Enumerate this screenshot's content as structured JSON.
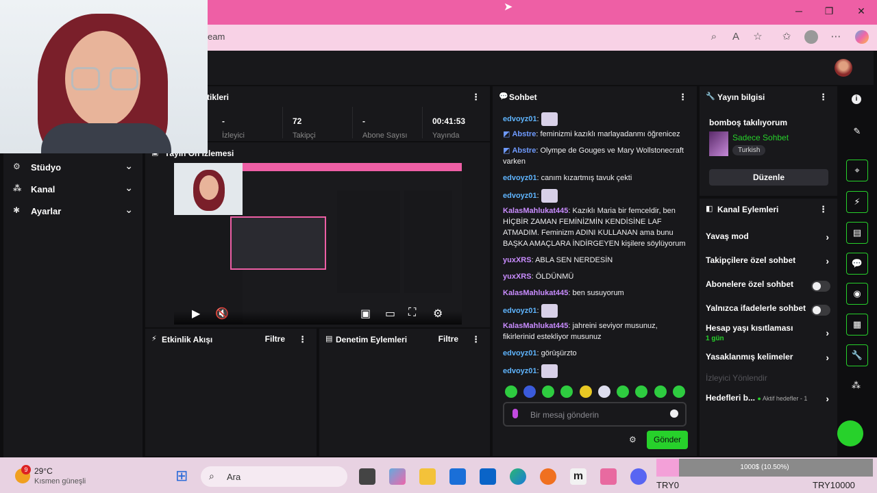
{
  "browser": {
    "url_text": "eam",
    "win_min": "─",
    "win_max": "❐",
    "win_close": "✕"
  },
  "sidebar": {
    "items": [
      {
        "label": "Stüdyo"
      },
      {
        "label": "Kanal"
      },
      {
        "label": "Ayarlar"
      }
    ]
  },
  "stats_panel": {
    "title": "tikleri",
    "stats": [
      {
        "value": "-",
        "label": "İzleyici"
      },
      {
        "value": "72",
        "label": "Takipçi"
      },
      {
        "value": "-",
        "label": "Abone Sayısı"
      },
      {
        "value": "00:41:53",
        "label": "Yayında"
      }
    ]
  },
  "preview_panel": {
    "title": "Yayın Ön İzlemesi"
  },
  "activity_panel": {
    "title": "Etkinlik Akışı",
    "filter": "Filtre"
  },
  "moderation_panel": {
    "title": "Denetim Eylemleri",
    "filter": "Filtre"
  },
  "chat": {
    "title": "Sohbet",
    "messages": [
      {
        "user": "edvoyz01",
        "text": "",
        "sticker": true
      },
      {
        "user": "Abstre",
        "text": "feminizmi kazıklı marlayadanmı öğrenicez"
      },
      {
        "user": "Abstre",
        "text": "Olympe de Gouges ve Mary Wollstonecraft varken"
      },
      {
        "user": "edvoyz01",
        "text": "canım kızartmış tavuk çekti"
      },
      {
        "user": "edvoyz01",
        "text": "",
        "sticker": true
      },
      {
        "user": "KalasMahlukat445",
        "text": "Kazıklı Maria bir femceldir, ben HİÇBİR ZAMAN FEMİNİZMİN KENDİSİNE LAF ATMADIM. Feminizm ADINI KULLANAN ama bunu BAŞKA AMAÇLARA İNDİRGEYEN kişilere söylüyorum"
      },
      {
        "user": "yuxXRS",
        "text": "ABLA SEN NERDESİN"
      },
      {
        "user": "yuxXRS",
        "text": "ÖLDÜNMÜ"
      },
      {
        "user": "KalasMahlukat445",
        "text": "ben susuyorum"
      },
      {
        "user": "edvoyz01",
        "text": "",
        "sticker": true
      },
      {
        "user": "KalasMahlukat445",
        "text": "jahreini seviyor musunuz, fikirlerinid estekliyor musunuz"
      },
      {
        "user": "edvoyz01",
        "text": "görüşürzto"
      },
      {
        "user": "edvoyz01",
        "text": "",
        "sticker": true
      }
    ],
    "input_placeholder": "Bir mesaj gönderin",
    "send_label": "Gönder"
  },
  "stream_info": {
    "title": "Yayın bilgisi",
    "stream_title": "bomboş takılıyorum",
    "category": "Sadece Sohbet",
    "tag": "Turkish",
    "edit_label": "Düzenle"
  },
  "channel_actions": {
    "title": "Kanal Eylemleri",
    "items": [
      {
        "label": "Yavaş mod",
        "control": "chevron"
      },
      {
        "label": "Takipçilere özel sohbet",
        "control": "chevron"
      },
      {
        "label": "Abonelere özel sohbet",
        "control": "toggle"
      },
      {
        "label": "Yalnızca ifadelerle sohbet",
        "control": "toggle"
      },
      {
        "label": "Hesap yaşı kısıtlaması",
        "sub": "1 gün",
        "control": "chevron"
      },
      {
        "label": "Yasaklanmış kelimeler",
        "control": "chevron"
      },
      {
        "label": "İzleyici Yönlendir",
        "control": "none"
      },
      {
        "label": "Hedefleri b...",
        "sub_inline": "Aktif hedefler - 1",
        "control": "chevron"
      }
    ]
  },
  "taskbar": {
    "weather_temp": "29°C",
    "weather_desc": "Kısmen güneşli",
    "weather_badge": "9",
    "search_label": "Ara",
    "progress_text": "1000$ (10.50%)",
    "currency_left": "TRY0",
    "currency_right": "TRY10000"
  },
  "colors": {
    "accent_green": "#27d12b",
    "browser_pink": "#ee5fa5",
    "panel_bg": "#18181b"
  }
}
